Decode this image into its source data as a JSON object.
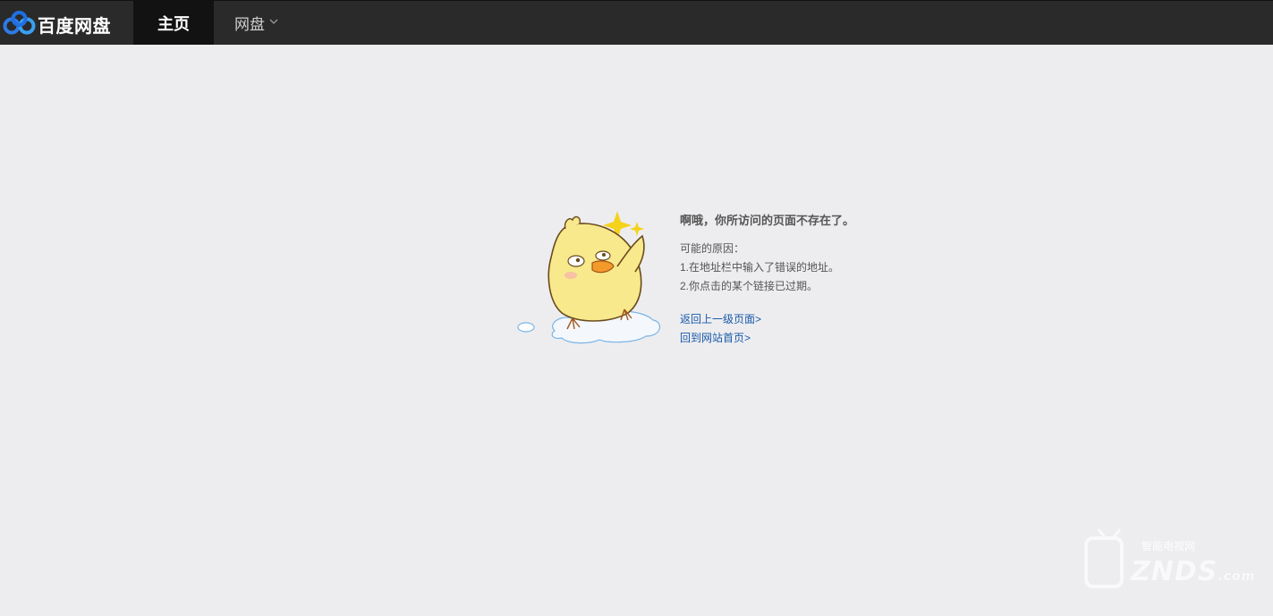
{
  "header": {
    "brand_name": "百度网盘",
    "nav_home": "主页",
    "nav_disk": "网盘"
  },
  "error": {
    "title": "啊哦，你所访问的页面不存在了。",
    "reasons_heading": "可能的原因：",
    "reason_1": "1.在地址栏中输入了错误的地址。",
    "reason_2": "2.你点击的某个链接已过期。",
    "link_back": "返回上一级页面>",
    "link_home": "回到网站首页>"
  },
  "watermark": {
    "text": "ZNDS",
    "suffix": ".com",
    "sub": "智能电视网"
  },
  "colors": {
    "topbar": "#2a2a2a",
    "active_tab": "#121212",
    "background": "#ededf0",
    "link": "#1a5aa8",
    "brand_blue": "#2e7ae6"
  },
  "icons": {
    "brand": "baidu-netdisk-cloud-icon",
    "dropdown": "chevron-down-icon",
    "illustration": "yellow-chick-illustration"
  }
}
